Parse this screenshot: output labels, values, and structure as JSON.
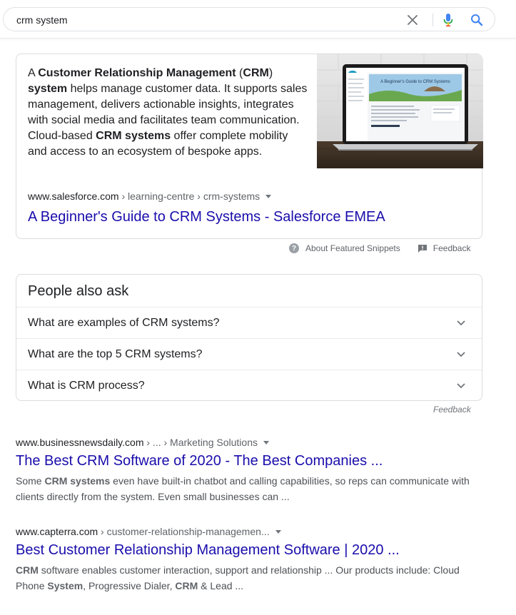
{
  "search": {
    "query": "crm system",
    "clear_icon": "close-icon",
    "voice_icon": "mic-icon",
    "submit_icon": "search-icon"
  },
  "featured_snippet": {
    "text": {
      "p1": "A ",
      "b1": "Customer Relationship Management",
      "p2": " (",
      "b2": "CRM",
      "p3": ") ",
      "b3": "system",
      "p4": " helps manage customer data. It supports sales management, delivers actionable insights, integrates with social media and facilitates team communication. Cloud-based ",
      "b4": "CRM systems",
      "p5": " offer complete mobility and access to an ecosystem of bespoke apps."
    },
    "image_title": "A Beginner's Guide to CRM Systems",
    "cite_domain": "www.salesforce.com",
    "cite_path": " › learning-centre › crm-systems",
    "title": "A Beginner's Guide to CRM Systems - Salesforce EMEA",
    "about_label": "About Featured Snippets",
    "feedback_label": "Feedback"
  },
  "people_also_ask": {
    "heading": "People also ask",
    "questions": [
      "What are examples of CRM systems?",
      "What are the top 5 CRM systems?",
      "What is CRM process?"
    ],
    "feedback_label": "Feedback"
  },
  "results": [
    {
      "cite_domain": "www.businessnewsdaily.com",
      "cite_path": " › ... › Marketing Solutions",
      "title": "The Best CRM Software of 2020 - The Best Companies ...",
      "desc": {
        "p1": "Some ",
        "b1": "CRM systems",
        "p2": " even have built-in chatbot and calling capabilities, so reps can communicate with clients directly from the system. Even small businesses can ..."
      }
    },
    {
      "cite_domain": "www.capterra.com",
      "cite_path": " › customer-relationship-managemen...",
      "title": "Best Customer Relationship Management Software | 2020 ...",
      "desc": {
        "b1": "CRM",
        "p1": " software enables customer interaction, support and relationship ... Our products include: Cloud Phone ",
        "b2": "System",
        "p2": ", Progressive Dialer, ",
        "b3": "CRM",
        "p3": " & Lead ..."
      }
    }
  ],
  "colors": {
    "link": "#1a0dab",
    "text": "#202124",
    "secondary": "#5f6368",
    "border": "#dadce0",
    "mic_blue": "#4285f4",
    "mic_red": "#ea4335"
  }
}
